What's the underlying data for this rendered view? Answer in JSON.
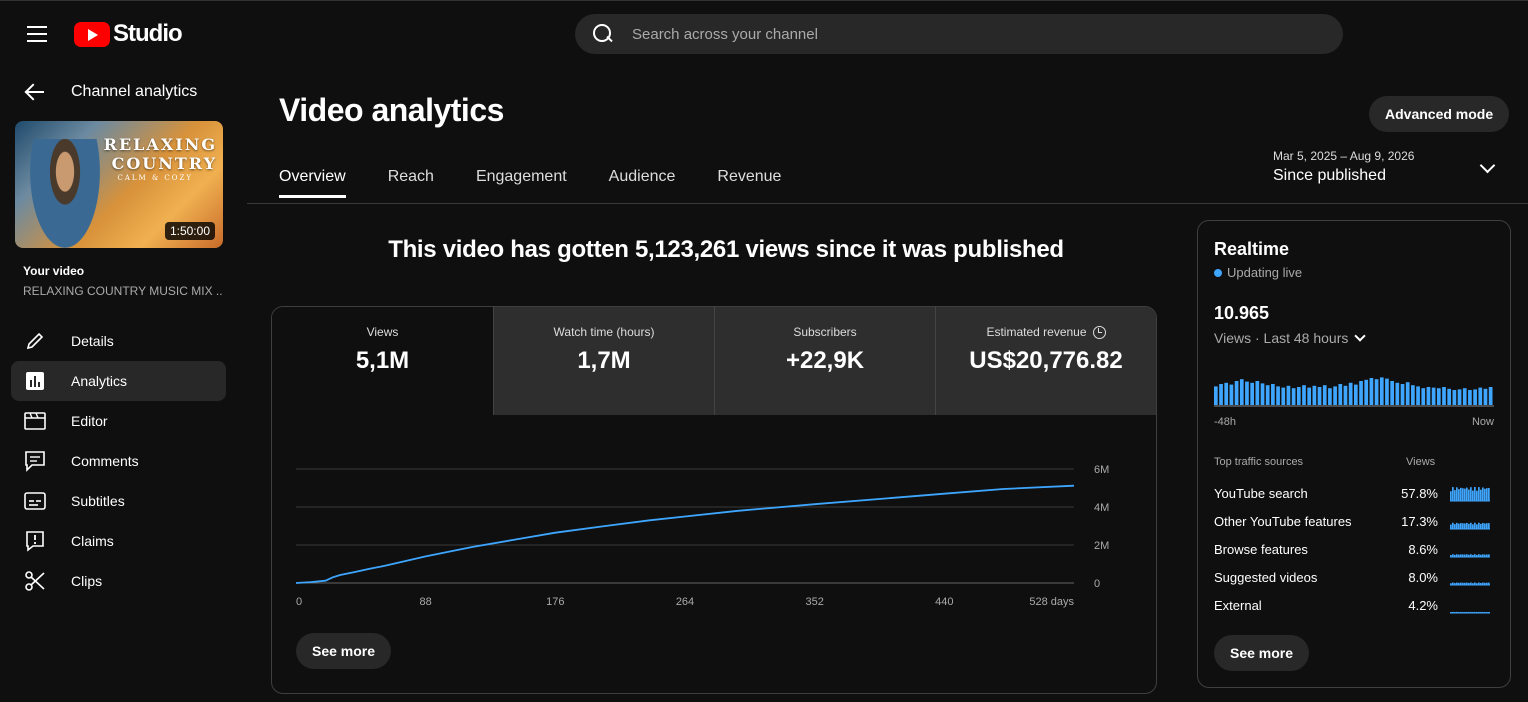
{
  "header": {
    "logo_text": "Studio",
    "search_placeholder": "Search across your channel"
  },
  "sidebar": {
    "back_label": "Channel analytics",
    "thumbnail": {
      "title_line1": "RELAXING",
      "title_line2": "COUNTRY",
      "subtitle": "CALM & COZY",
      "duration": "1:50:00"
    },
    "your_video_label": "Your video",
    "video_name": "RELAXING COUNTRY MUSIC MIX ...",
    "items": [
      {
        "label": "Details",
        "icon": "pencil-icon"
      },
      {
        "label": "Analytics",
        "icon": "analytics-icon"
      },
      {
        "label": "Editor",
        "icon": "editor-icon"
      },
      {
        "label": "Comments",
        "icon": "comments-icon"
      },
      {
        "label": "Subtitles",
        "icon": "subtitles-icon"
      },
      {
        "label": "Claims",
        "icon": "claims-icon"
      },
      {
        "label": "Clips",
        "icon": "scissors-icon"
      }
    ]
  },
  "main": {
    "title": "Video analytics",
    "advanced_mode": "Advanced mode",
    "tabs": [
      {
        "label": "Overview"
      },
      {
        "label": "Reach"
      },
      {
        "label": "Engagement"
      },
      {
        "label": "Audience"
      },
      {
        "label": "Revenue"
      }
    ],
    "date_range": {
      "dates": "Mar 5, 2025 – Aug 9, 2026",
      "label": "Since published"
    },
    "headline": "This video has gotten 5,123,261 views since it was published",
    "metrics": [
      {
        "label": "Views",
        "value": "5,1M"
      },
      {
        "label": "Watch time (hours)",
        "value": "1,7M"
      },
      {
        "label": "Subscribers",
        "value": "+22,9K"
      },
      {
        "label": "Estimated revenue",
        "value": "US$20,776.82"
      }
    ],
    "see_more": "See more"
  },
  "chart_data": {
    "type": "line",
    "x_ticks": [
      "0",
      "88",
      "176",
      "264",
      "352",
      "440",
      "528 days"
    ],
    "y_ticks": [
      "0",
      "2M",
      "4M",
      "6M"
    ],
    "ylim": [
      0,
      6000000
    ],
    "xlim": [
      0,
      528
    ],
    "series": [
      {
        "x": [
          0,
          10,
          20,
          25,
          30,
          40,
          50,
          60,
          88,
          120,
          150,
          176,
          210,
          240,
          264,
          300,
          352,
          400,
          440,
          480,
          528
        ],
        "values": [
          0,
          50000,
          120000,
          300000,
          420000,
          580000,
          750000,
          900000,
          1400000,
          1900000,
          2300000,
          2650000,
          3000000,
          3300000,
          3500000,
          3800000,
          4150000,
          4450000,
          4700000,
          4950000,
          5123261
        ]
      }
    ],
    "color": "#3ea6ff"
  },
  "realtime": {
    "title": "Realtime",
    "live_label": "Updating live",
    "value": "10.965",
    "sub_label": "Views · Last 48 hours",
    "axis_start": "-48h",
    "axis_end": "Now",
    "bars": [
      0.62,
      0.7,
      0.74,
      0.68,
      0.8,
      0.86,
      0.78,
      0.74,
      0.8,
      0.72,
      0.66,
      0.7,
      0.62,
      0.58,
      0.64,
      0.56,
      0.6,
      0.66,
      0.58,
      0.64,
      0.6,
      0.66,
      0.56,
      0.62,
      0.7,
      0.64,
      0.74,
      0.68,
      0.8,
      0.84,
      0.9,
      0.86,
      0.92,
      0.88,
      0.8,
      0.74,
      0.7,
      0.76,
      0.66,
      0.62,
      0.56,
      0.6,
      0.58,
      0.56,
      0.6,
      0.54,
      0.5,
      0.52,
      0.56,
      0.5,
      0.52,
      0.58,
      0.54,
      0.6
    ],
    "traffic_header": "Top traffic sources",
    "traffic_views_header": "Views",
    "sources": [
      {
        "name": "YouTube search",
        "pct": "57.8%",
        "level": 1.0
      },
      {
        "name": "Other YouTube features",
        "pct": "17.3%",
        "level": 0.45
      },
      {
        "name": "Browse features",
        "pct": "8.6%",
        "level": 0.2
      },
      {
        "name": "Suggested videos",
        "pct": "8.0%",
        "level": 0.18
      },
      {
        "name": "External",
        "pct": "4.2%",
        "level": 0.08
      }
    ],
    "see_more": "See more"
  }
}
